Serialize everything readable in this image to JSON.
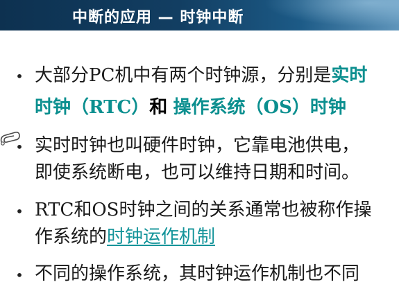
{
  "header": {
    "title": "中断的应用 — 时钟中断"
  },
  "bullets": [
    {
      "line1_a": "大部分PC机中有两个时钟源，分别是",
      "line1_b": "实时",
      "line2_a": "时钟（RTC）",
      "line2_b": "和",
      "line2_c": "操作系统（OS）时钟"
    },
    {
      "line1": "实时时钟也叫硬件时钟，它靠电池供电，",
      "line2": "即使系统断电，也可以维持日期和时间。"
    },
    {
      "line1": "RTC和OS时钟之间的关系通常也被称作操",
      "line2_a": "作系统的",
      "line2_link": "时钟运作机制"
    },
    {
      "line1": "不同的操作系统，其时钟运作机制也不同"
    }
  ],
  "bullet_symbol": "•",
  "colors": {
    "accent": "#0b8f8f",
    "header_dark": "#0d3150",
    "header_light": "#5f95bb"
  }
}
